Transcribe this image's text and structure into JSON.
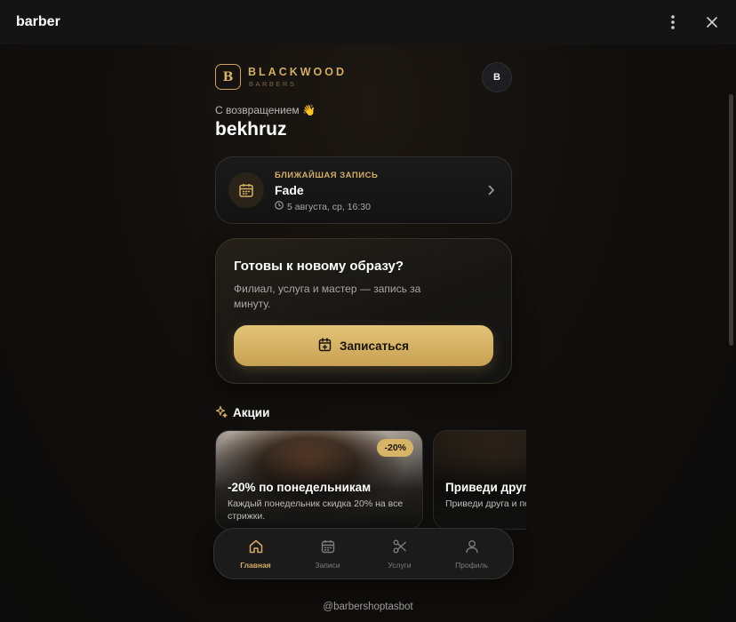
{
  "window": {
    "title": "barber",
    "menu_icon": "more-vertical-icon",
    "close_icon": "close-icon"
  },
  "brand": {
    "logo_letter": "B",
    "name": "BLACKWOOD",
    "sub": "BARBERS",
    "accent": "#d3ad63"
  },
  "user": {
    "avatar_letter": "B",
    "welcome": "С возвращением 👋",
    "name": "bekhruz"
  },
  "appointment": {
    "kicker": "БЛИЖАЙШАЯ ЗАПИСЬ",
    "service": "Fade",
    "datetime": "5 августа, ср, 16:30"
  },
  "booking": {
    "title": "Готовы к новому образу?",
    "description": "Филиал, услуга и мастер — запись за минуту.",
    "button": "Записаться"
  },
  "promos": {
    "heading": "Акции",
    "items": [
      {
        "badge": "-20%",
        "title": "-20% по понедельникам",
        "description": "Каждый понедельник скидка 20% на все стрижки."
      },
      {
        "title": "Приведи друга",
        "description": "Приведи друга и получи скидку на счёт."
      }
    ]
  },
  "nav": {
    "items": [
      {
        "label": "Главная",
        "icon": "home-icon",
        "active": true
      },
      {
        "label": "Записи",
        "icon": "calendar-icon",
        "active": false
      },
      {
        "label": "Услуги",
        "icon": "scissors-icon",
        "active": false
      },
      {
        "label": "Профиль",
        "icon": "user-icon",
        "active": false
      }
    ]
  },
  "footer": {
    "bot_handle": "@barbershoptasbot"
  }
}
